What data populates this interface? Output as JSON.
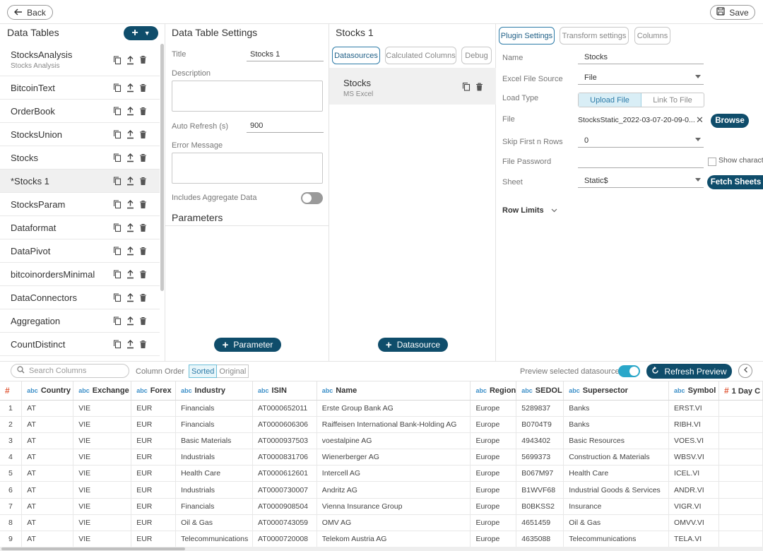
{
  "topbar": {
    "back_label": "Back",
    "save_label": "Save"
  },
  "data_tables": {
    "title": "Data Tables",
    "items": [
      {
        "name": "StocksAnalysis",
        "sub": "Stocks Analysis"
      },
      {
        "name": "BitcoinText"
      },
      {
        "name": "OrderBook"
      },
      {
        "name": "StocksUnion"
      },
      {
        "name": "Stocks"
      },
      {
        "name": "*Stocks 1"
      },
      {
        "name": "StocksParam"
      },
      {
        "name": "Dataformat"
      },
      {
        "name": "DataPivot"
      },
      {
        "name": "bitcoinordersMinimal"
      },
      {
        "name": "DataConnectors"
      },
      {
        "name": "Aggregation"
      },
      {
        "name": "CountDistinct"
      }
    ]
  },
  "settings": {
    "title": "Data Table Settings",
    "title_label": "Title",
    "title_value": "Stocks 1",
    "description_label": "Description",
    "auto_refresh_label": "Auto Refresh (s)",
    "auto_refresh_value": "900",
    "error_message_label": "Error Message",
    "aggregate_label": "Includes Aggregate Data",
    "parameters_title": "Parameters",
    "parameter_button": "Parameter"
  },
  "datasources": {
    "title": "Stocks 1",
    "tabs": [
      "Datasources",
      "Calculated Columns",
      "Debug"
    ],
    "card_name": "Stocks",
    "card_type": "MS Excel",
    "add_button": "Datasource"
  },
  "plugin": {
    "tabs": [
      "Plugin Settings",
      "Transform settings",
      "Columns"
    ],
    "name_label": "Name",
    "name_value": "Stocks",
    "source_label": "Excel File Source",
    "source_value": "File",
    "load_type_label": "Load Type",
    "load_type_options": [
      "Upload File",
      "Link To File"
    ],
    "file_label": "File",
    "file_value": "StocksStatic_2022-03-07-20-09-0...",
    "browse_button": "Browse",
    "skip_label": "Skip First n Rows",
    "skip_value": "0",
    "password_label": "File Password",
    "show_chars_label": "Show charact",
    "sheet_label": "Sheet",
    "sheet_value": "Static$",
    "fetch_button": "Fetch Sheets",
    "row_limits_label": "Row Limits"
  },
  "preview": {
    "search_placeholder": "Search Columns",
    "column_order_label": "Column Order",
    "order_options": [
      "Sorted",
      "Original"
    ],
    "preview_selected_label": "Preview selected datasource",
    "refresh_button": "Refresh Preview"
  },
  "grid": {
    "headers": [
      {
        "type": "#",
        "label": ""
      },
      {
        "type": "abc",
        "label": "Country"
      },
      {
        "type": "abc",
        "label": "Exchange"
      },
      {
        "type": "abc",
        "label": "Forex"
      },
      {
        "type": "abc",
        "label": "Industry"
      },
      {
        "type": "abc",
        "label": "ISIN"
      },
      {
        "type": "abc",
        "label": "Name"
      },
      {
        "type": "abc",
        "label": "Region"
      },
      {
        "type": "abc",
        "label": "SEDOL"
      },
      {
        "type": "abc",
        "label": "Supersector"
      },
      {
        "type": "abc",
        "label": "Symbol"
      },
      {
        "type": "#",
        "label": "1 Day C"
      }
    ],
    "rows": [
      [
        "1",
        "AT",
        "VIE",
        "EUR",
        "Financials",
        "AT0000652011",
        "Erste Group Bank AG",
        "Europe",
        "5289837",
        "Banks",
        "ERST.VI",
        ""
      ],
      [
        "2",
        "AT",
        "VIE",
        "EUR",
        "Financials",
        "AT0000606306",
        "Raiffeisen International Bank-Holding AG",
        "Europe",
        "B0704T9",
        "Banks",
        "RIBH.VI",
        ""
      ],
      [
        "3",
        "AT",
        "VIE",
        "EUR",
        "Basic Materials",
        "AT0000937503",
        "voestalpine AG",
        "Europe",
        "4943402",
        "Basic Resources",
        "VOES.VI",
        ""
      ],
      [
        "4",
        "AT",
        "VIE",
        "EUR",
        "Industrials",
        "AT0000831706",
        "Wienerberger AG",
        "Europe",
        "5699373",
        "Construction & Materials",
        "WBSV.VI",
        ""
      ],
      [
        "5",
        "AT",
        "VIE",
        "EUR",
        "Health Care",
        "AT0000612601",
        "Intercell AG",
        "Europe",
        "B067M97",
        "Health Care",
        "ICEL.VI",
        ""
      ],
      [
        "6",
        "AT",
        "VIE",
        "EUR",
        "Industrials",
        "AT0000730007",
        "Andritz AG",
        "Europe",
        "B1WVF68",
        "Industrial Goods & Services",
        "ANDR.VI",
        ""
      ],
      [
        "7",
        "AT",
        "VIE",
        "EUR",
        "Financials",
        "AT0000908504",
        "Vienna Insurance Group",
        "Europe",
        "B0BKSS2",
        "Insurance",
        "VIGR.VI",
        ""
      ],
      [
        "8",
        "AT",
        "VIE",
        "EUR",
        "Oil & Gas",
        "AT0000743059",
        "OMV AG",
        "Europe",
        "4651459",
        "Oil & Gas",
        "OMVV.VI",
        ""
      ],
      [
        "9",
        "AT",
        "VIE",
        "EUR",
        "Telecommunications",
        "AT0000720008",
        "Telekom Austria AG",
        "Europe",
        "4635088",
        "Telecommunications",
        "TELA.VI",
        ""
      ]
    ]
  }
}
